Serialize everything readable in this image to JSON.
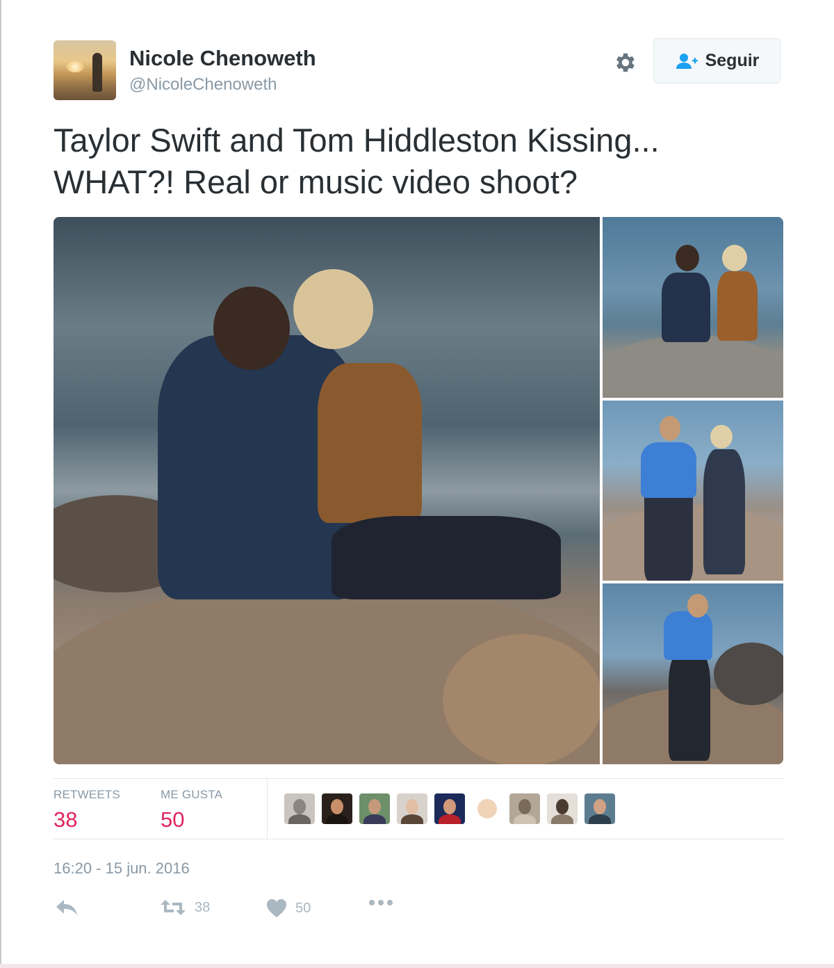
{
  "user": {
    "display_name": "Nicole Chenoweth",
    "screen_name": "@NicoleChenoweth"
  },
  "header": {
    "follow_label": "Seguir",
    "settings_icon": "gear-icon",
    "follow_icon": "add-user-icon"
  },
  "tweet": {
    "text_line1": "Taylor Swift and Tom Hiddleston Kissing...",
    "text_line2": "WHAT?! Real or music video shoot?",
    "photo_count": 4
  },
  "stats": {
    "retweets_label": "RETWEETS",
    "retweets_value": "38",
    "likes_label": "ME GUSTA",
    "likes_value": "50",
    "liker_avatar_count": 9
  },
  "timestamp": "16:20 - 15 jun. 2016",
  "actions": {
    "reply_icon": "reply-icon",
    "retweet_icon": "retweet-icon",
    "retweet_count": "38",
    "like_icon": "heart-icon",
    "like_count": "50",
    "more_icon": "more-icon"
  },
  "colors": {
    "accent_blue": "#1da1f2",
    "like_pink": "#e0245e",
    "secondary_text": "#8899a6",
    "primary_text": "#292f33"
  }
}
